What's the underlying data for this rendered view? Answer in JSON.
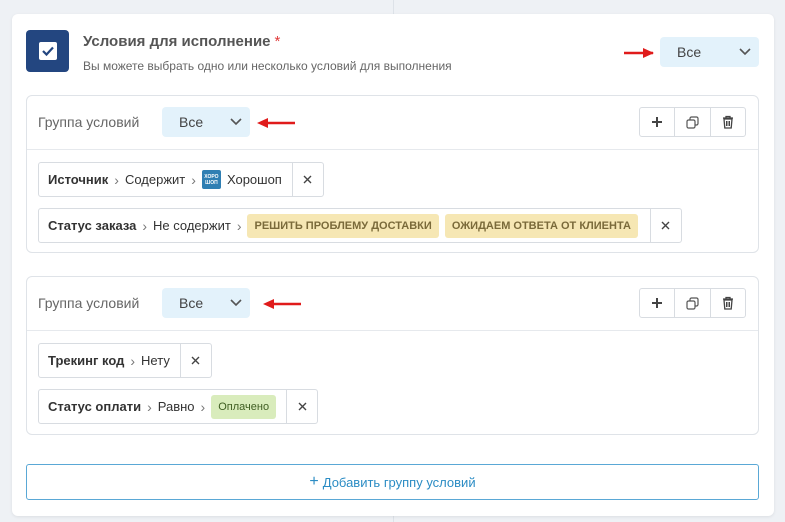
{
  "header": {
    "title": "Условия для исполнение",
    "required_mark": "*",
    "subtitle": "Вы можете выбрать одно или несколько условий для выполнения",
    "match_select": "Все"
  },
  "groups": [
    {
      "title": "Группа условий",
      "match_select": "Все",
      "conditions": [
        {
          "field": "Источник",
          "operator": "Содержит",
          "value": "Хорошоп",
          "value_logo": "ХОРО ШОП"
        },
        {
          "field": "Статус заказа",
          "operator": "Не содержит",
          "tags": [
            "РЕШИТЬ ПРОБЛЕМУ ДОСТАВКИ",
            "ОЖИДАЕМ ОТВЕТА ОТ КЛИЕНТА"
          ]
        }
      ]
    },
    {
      "title": "Группа условий",
      "match_select": "Все",
      "conditions": [
        {
          "field": "Трекинг код",
          "operator": "Нету"
        },
        {
          "field": "Статус оплати",
          "operator": "Равно",
          "tags": [
            "Оплачено"
          ]
        }
      ]
    }
  ],
  "add_group_label": "Добавить группу условий",
  "icons": {
    "header": "checkbox-icon",
    "add": "plus-icon",
    "copy": "copy-icon",
    "delete": "trash-icon",
    "remove": "close-icon",
    "chevron": "chevron-down-icon",
    "annotation": "red-arrow-icon"
  },
  "colors": {
    "header_icon_bg": "#234680",
    "select_bg": "#e3f2fb",
    "accent": "#2b8cc4",
    "annotation_arrow": "#e01b1b",
    "tag_yellow": "#f6e7b4",
    "tag_green": "#d9ecbc"
  }
}
